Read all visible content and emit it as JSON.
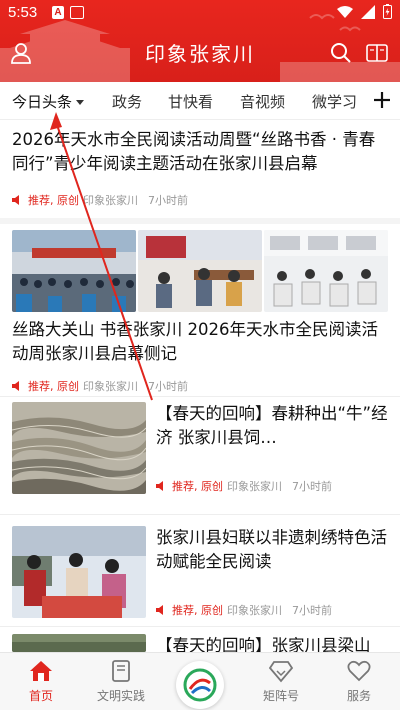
{
  "status": {
    "time": "5:53",
    "badge": "A"
  },
  "header": {
    "title": "印象张家川"
  },
  "tabs": [
    {
      "label": "今日头条"
    },
    {
      "label": "政务"
    },
    {
      "label": "甘快看"
    },
    {
      "label": "音视频"
    },
    {
      "label": "微学习"
    }
  ],
  "feed": {
    "item1": {
      "title": "2026年天水市全民阅读活动周暨“丝路书香 · 青春同行”青少年阅读主题活动在张家川县启幕",
      "tags": "推荐, 原创",
      "source": "印象张家川",
      "time": "7小时前"
    },
    "item2": {
      "title": "丝路大关山 书香张家川 2026年天水市全民阅读活动周张家川县启幕侧记",
      "tags": "推荐, 原创",
      "source": "印象张家川",
      "time": "7小时前"
    },
    "item3": {
      "title": "【春天的回响】春耕种出“牛”经济 张家川县饲…",
      "tags": "推荐, 原创",
      "source": "印象张家川",
      "time": "7小时前"
    },
    "item4": {
      "title": "张家川县妇联以非遗刺绣特色活动赋能全民阅读",
      "tags": "推荐, 原创",
      "source": "印象张家川",
      "time": "7小时前"
    },
    "item5": {
      "title": "【春天的回响】张家川县梁山"
    }
  },
  "bottomnav": [
    {
      "label": "首页"
    },
    {
      "label": "文明实践"
    },
    {
      "label": ""
    },
    {
      "label": "矩阵号"
    },
    {
      "label": "服务"
    }
  ],
  "colors": {
    "brand": "#e0261e",
    "header": "#d8201a"
  }
}
